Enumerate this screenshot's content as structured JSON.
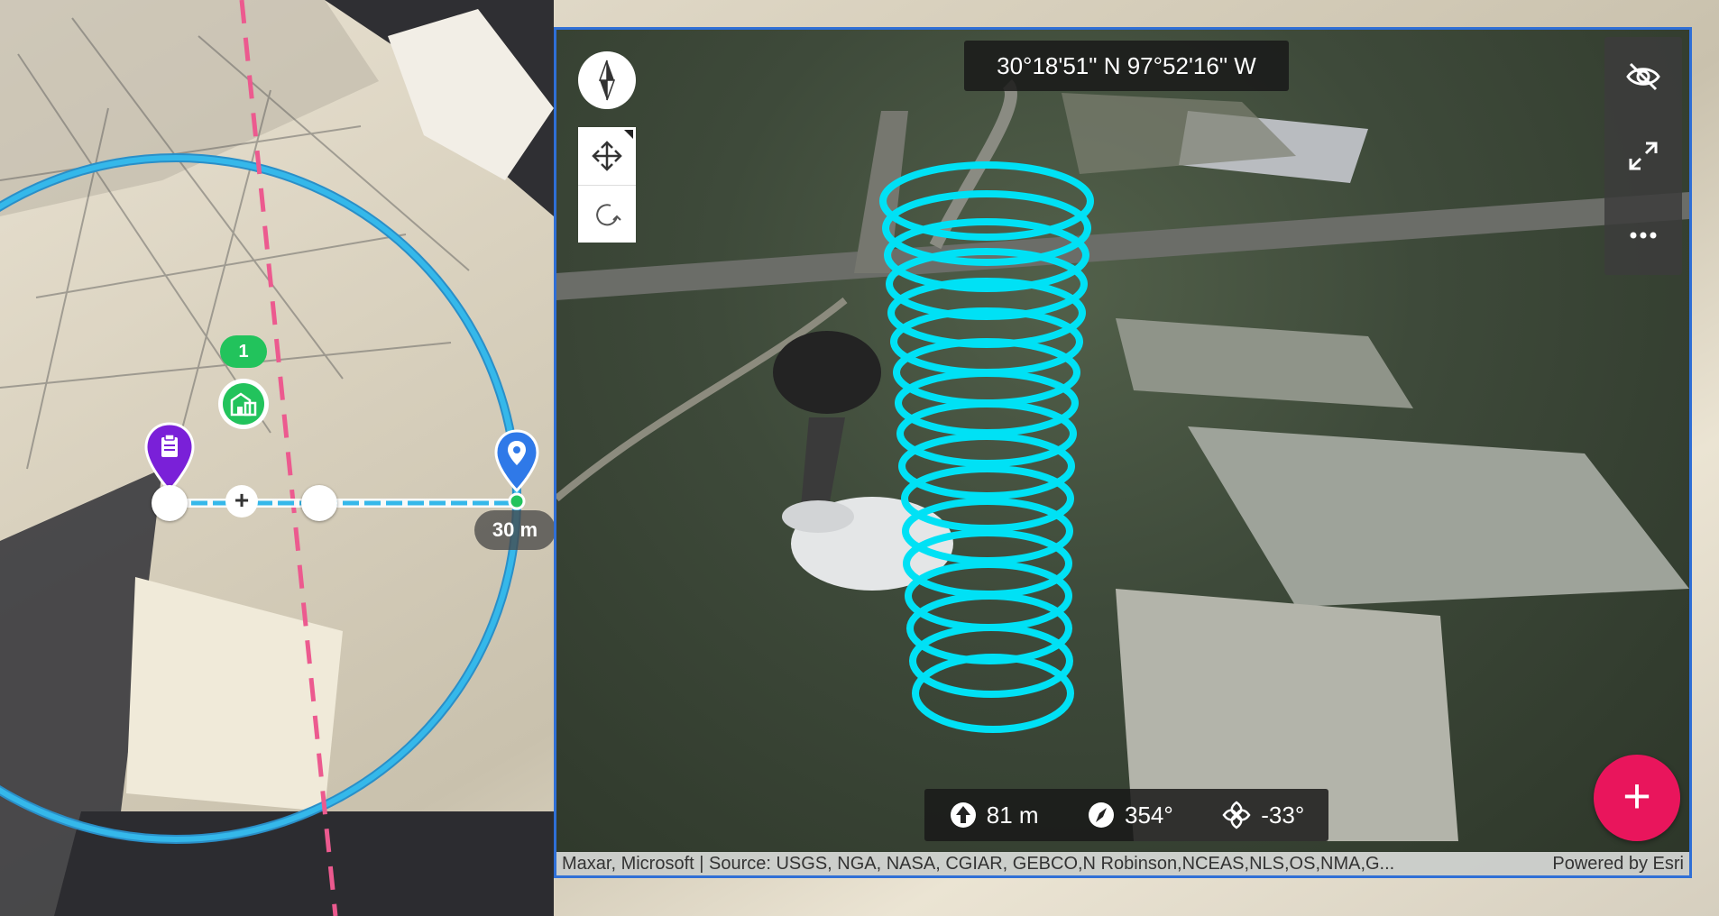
{
  "map2d": {
    "waypoint_count": "1",
    "distance_label": "30 m",
    "colors": {
      "geofence": "#35b8ea",
      "flight_line": "#ec5a8f",
      "waypoint_marker": "#7a20d8",
      "home_marker": "#2f79e8",
      "badge": "#22c35c"
    },
    "icons": [
      "clipboard-marker-icon",
      "building-icon",
      "location-pin-icon",
      "plus-icon"
    ]
  },
  "view3d": {
    "coordinates": "30°18'51\" N 97°52'16\" W",
    "stats": {
      "altitude": "81 m",
      "heading": "354°",
      "pitch": "-33°"
    },
    "attribution": "Maxar, Microsoft | Source: USGS, NGA, NASA, CGIAR, GEBCO,N Robinson,NCEAS,NLS,OS,NMA,G...",
    "powered_by": "Powered by Esri",
    "icons": [
      "compass-icon",
      "pan-icon",
      "rotate-icon",
      "visibility-off-icon",
      "fullscreen-icon",
      "more-options-icon",
      "altitude-icon",
      "heading-icon",
      "pitch-icon",
      "add-icon"
    ],
    "colors": {
      "panel_border": "#2f6fd6",
      "spiral": "#00e1f5",
      "fab": "#e9155c"
    }
  }
}
